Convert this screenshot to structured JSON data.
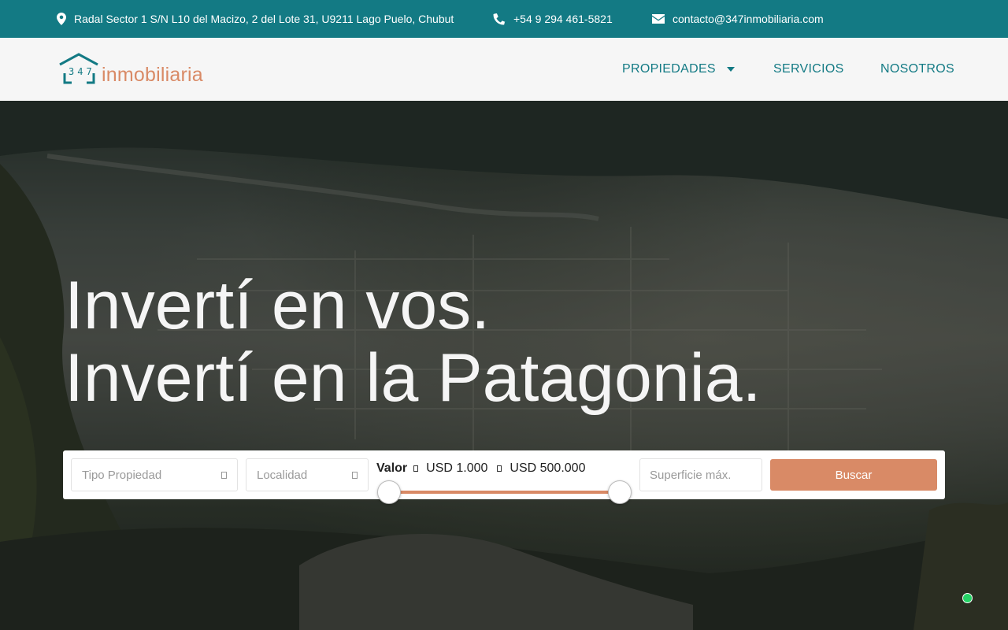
{
  "topbar": {
    "address": "Radal Sector 1 S/N L10 del Macizo, 2 del Lote 31, U9211 Lago Puelo, Chubut",
    "phone": "+54 9 294 461-5821",
    "email": "contacto@347inmobiliaria.com"
  },
  "logo": {
    "number": "347",
    "text": "inmobiliaria"
  },
  "nav": {
    "items": [
      {
        "label": "PROPIEDADES"
      },
      {
        "label": "SERVICIOS"
      },
      {
        "label": "NOSOTROS"
      }
    ]
  },
  "hero": {
    "line1": "Invertí en vos.",
    "line2": "Invertí en la Patagonia."
  },
  "search": {
    "tipo_placeholder": "Tipo Propiedad",
    "localidad_placeholder": "Localidad",
    "valor_label": "Valor",
    "valor_min": "USD 1.000",
    "valor_max": "USD 500.000",
    "superficie_placeholder": "Superficie máx.",
    "buscar_label": "Buscar"
  },
  "colors": {
    "teal": "#137a84",
    "accent": "#d98a66"
  }
}
